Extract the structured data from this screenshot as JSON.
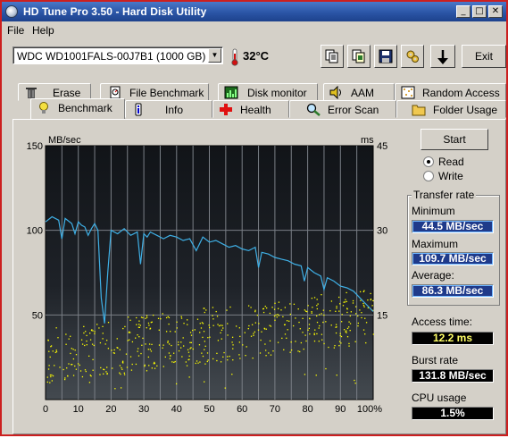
{
  "window": {
    "title": "HD Tune Pro 3.50 - Hard Disk Utility",
    "min_symbol": "_",
    "max_symbol": "□",
    "close_symbol": "✕"
  },
  "menu": {
    "file": "File",
    "help": "Help"
  },
  "toolbar": {
    "drive": "WDC WD1001FALS-00J7B1 (1000 GB)",
    "temperature": "32°C",
    "exit_label": "Exit",
    "icons": [
      "copy-icon",
      "copy-info-icon",
      "save-icon",
      "options-icon",
      "down-arrow-icon"
    ]
  },
  "tabs": {
    "row1": [
      {
        "label": "Erase",
        "icon": "trash-icon"
      },
      {
        "label": "File Benchmark",
        "icon": "file-benchmark-icon"
      },
      {
        "label": "Disk monitor",
        "icon": "disk-monitor-icon"
      },
      {
        "label": "AAM",
        "icon": "speaker-icon"
      },
      {
        "label": "Random Access",
        "icon": "random-access-icon"
      }
    ],
    "row2": [
      {
        "label": "Benchmark",
        "icon": "bulb-icon",
        "active": true
      },
      {
        "label": "Info",
        "icon": "info-icon"
      },
      {
        "label": "Health",
        "icon": "health-cross-icon"
      },
      {
        "label": "Error Scan",
        "icon": "magnifier-icon"
      },
      {
        "label": "Folder Usage",
        "icon": "folder-icon"
      }
    ]
  },
  "controls": {
    "start_label": "Start",
    "read_label": "Read",
    "write_label": "Write",
    "selected_mode": "Read"
  },
  "results": {
    "transfer_rate_title": "Transfer rate",
    "minimum_label": "Minimum",
    "minimum_value": "44.5 MB/sec",
    "maximum_label": "Maximum",
    "maximum_value": "109.7 MB/sec",
    "average_label": "Average:",
    "average_value": "86.3 MB/sec",
    "access_time_label": "Access time:",
    "access_time_value": "12.2 ms",
    "burst_rate_label": "Burst rate",
    "burst_rate_value": "131.8 MB/sec",
    "cpu_usage_label": "CPU usage",
    "cpu_usage_value": "1.5%"
  },
  "chart_data": {
    "type": "line",
    "ylabel_left": "MB/sec",
    "ylabel_right": "ms",
    "ylim_left": [
      0,
      150
    ],
    "ylim_right": [
      0,
      45
    ],
    "left_ticks": [
      "150",
      "100",
      "50"
    ],
    "right_ticks": [
      "45",
      "30",
      "15"
    ],
    "xlim": [
      0,
      100
    ],
    "x_ticks": [
      "0",
      "10",
      "20",
      "30",
      "40",
      "50",
      "60",
      "70",
      "80",
      "90",
      "100%"
    ],
    "grid": true,
    "series": [
      {
        "name": "Transfer rate",
        "axis": "left",
        "color": "#3fb0e6",
        "x": [
          0,
          2,
          4,
          5,
          6,
          8,
          9,
          10,
          11,
          12,
          13,
          14,
          15,
          16,
          17,
          18,
          19,
          20,
          22,
          24,
          26,
          28,
          29,
          30,
          31,
          32,
          34,
          36,
          38,
          40,
          42,
          44,
          46,
          48,
          50,
          52,
          54,
          56,
          58,
          60,
          62,
          64,
          65,
          66,
          68,
          70,
          72,
          74,
          76,
          78,
          79,
          80,
          82,
          84,
          85,
          86,
          88,
          90,
          92,
          94,
          96,
          98,
          100
        ],
        "y": [
          105,
          108,
          106,
          95,
          107,
          104,
          98,
          105,
          103,
          102,
          97,
          101,
          104,
          100,
          60,
          45,
          75,
          100,
          98,
          101,
          97,
          99,
          80,
          98,
          96,
          99,
          97,
          95,
          97,
          96,
          94,
          95,
          88,
          96,
          93,
          94,
          92,
          90,
          91,
          89,
          88,
          90,
          78,
          87,
          86,
          84,
          83,
          82,
          80,
          79,
          70,
          78,
          75,
          73,
          65,
          72,
          70,
          67,
          66,
          64,
          60,
          56,
          52
        ]
      },
      {
        "name": "Access time",
        "axis": "right",
        "type": "scatter",
        "color": "#ffff00",
        "values_ms_range": [
          6,
          22
        ],
        "average_ms": 12.2
      }
    ]
  }
}
